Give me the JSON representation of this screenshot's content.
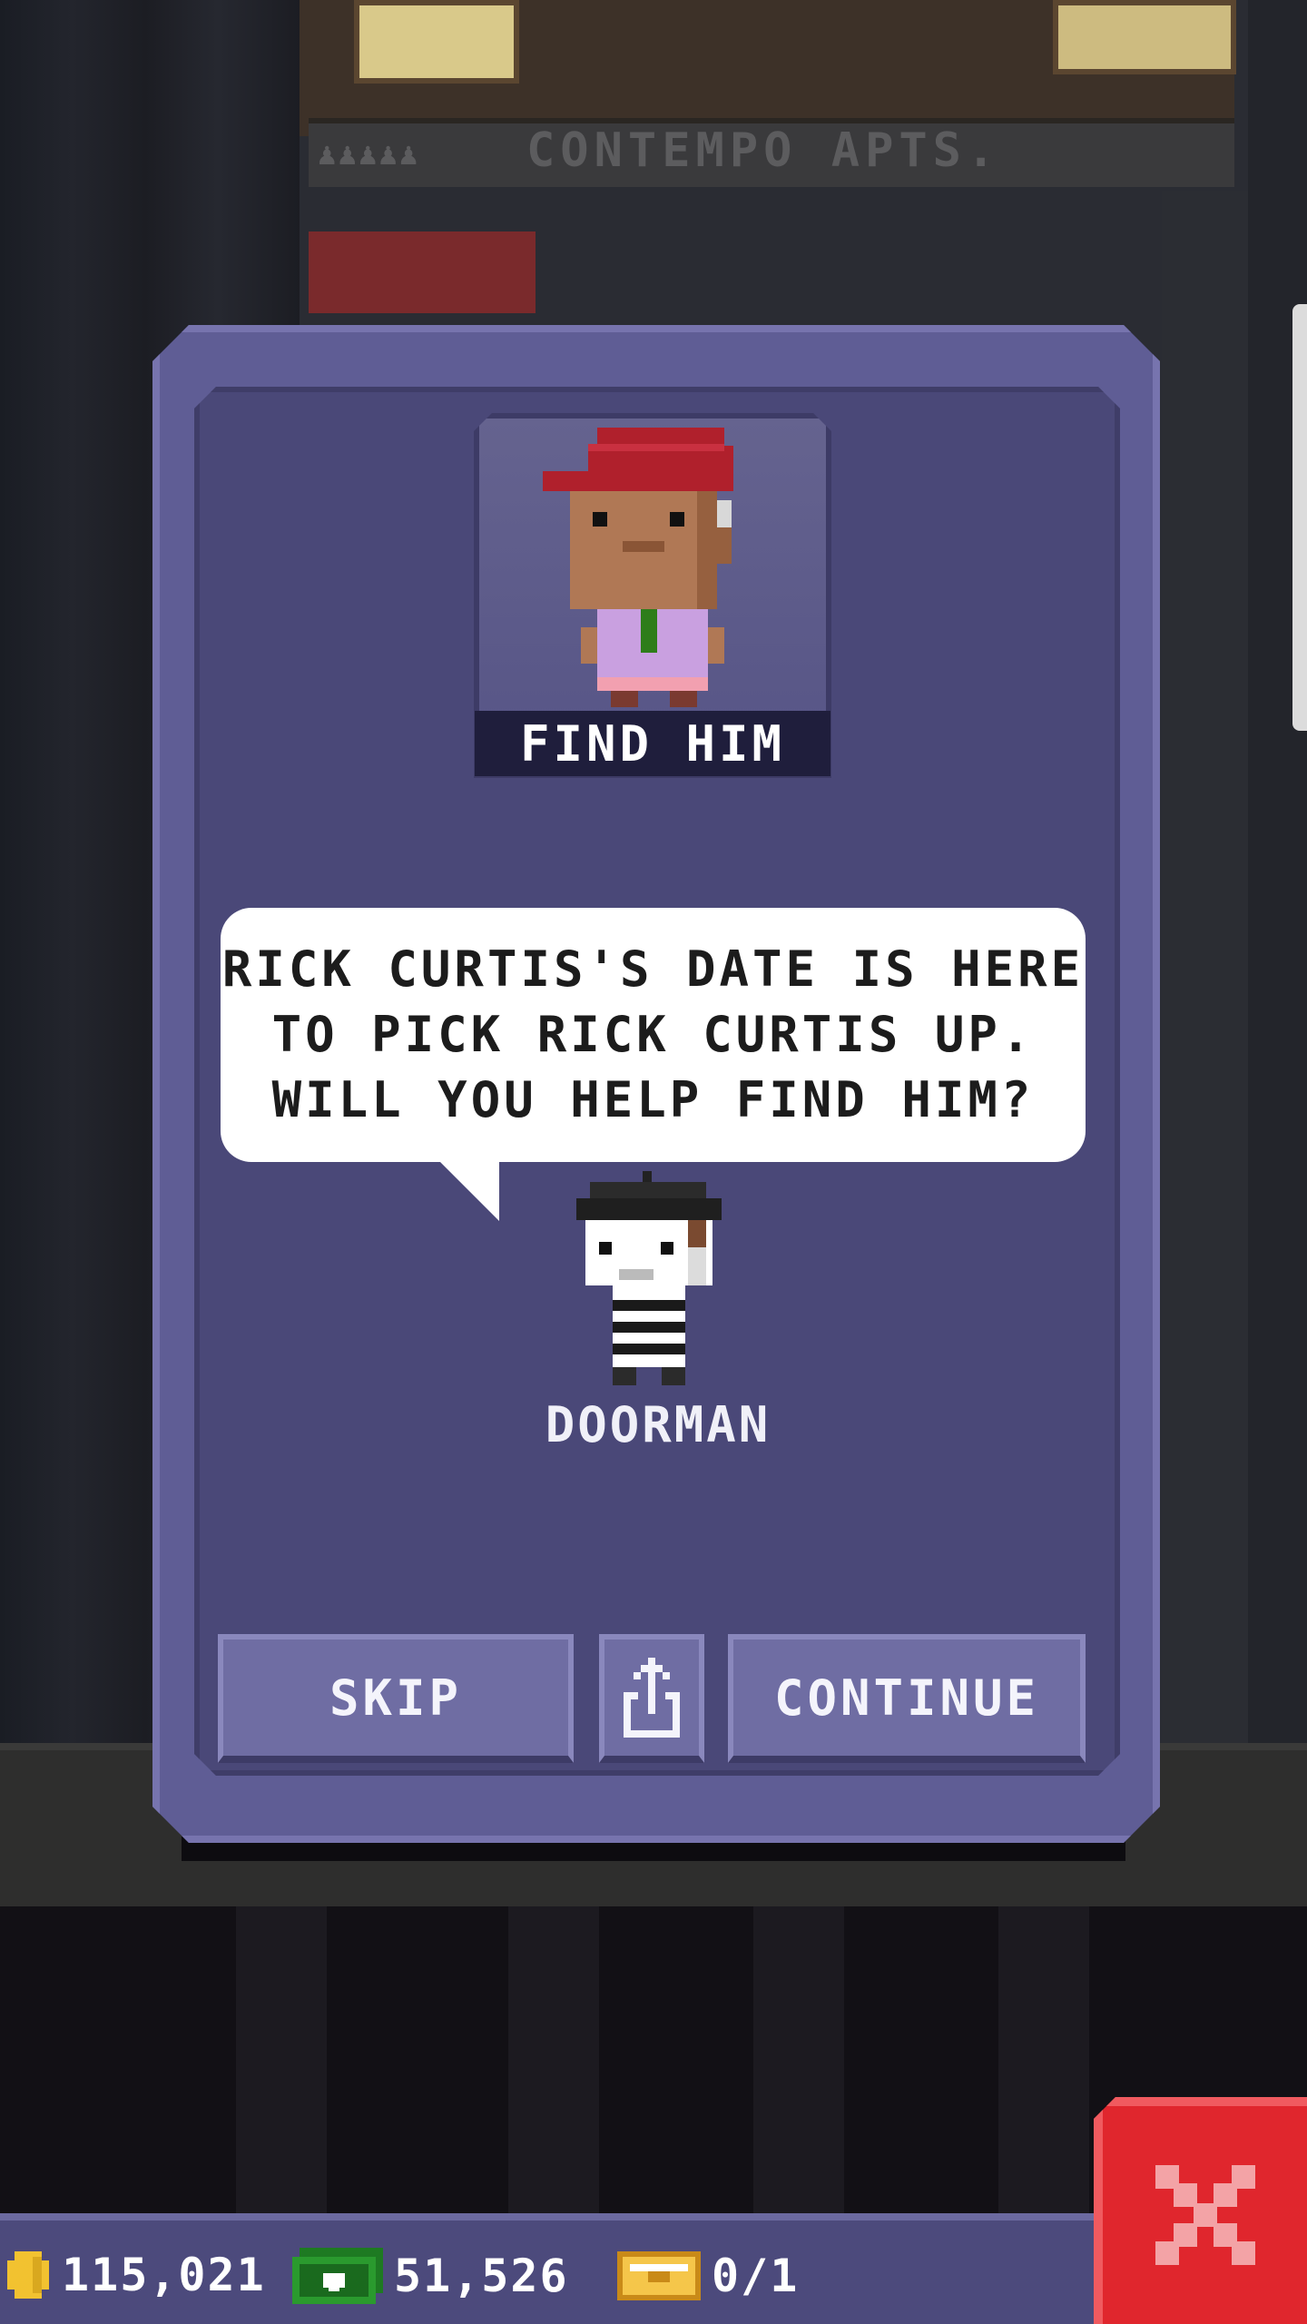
{
  "background": {
    "building_sign": "CONTEMPO APTS.",
    "people_icons": "♟♟♟♟♟"
  },
  "dialog": {
    "portrait_label": "FIND HIM",
    "speech_line1": "RICK CURTIS'S DATE IS HERE",
    "speech_line2": "TO PICK RICK CURTIS UP.",
    "speech_line3": "WILL YOU HELP FIND HIM?",
    "npc_name": "DOORMAN",
    "skip_label": "SKIP",
    "continue_label": "CONTINUE",
    "share_icon": "share-icon"
  },
  "hud": {
    "coins": "115,021",
    "bux": "51,526",
    "tickets": "0/1",
    "coin_icon": "coin-icon",
    "bux_icon": "bux-icon",
    "ticket_icon": "golden-ticket-icon"
  },
  "colors": {
    "dialog_bg": "#5f5d95",
    "dialog_inner": "#4a4878",
    "button": "#6f6da3",
    "close_red": "#e0262d",
    "coin_gold": "#f2c230",
    "bux_green": "#2a9a2e"
  }
}
